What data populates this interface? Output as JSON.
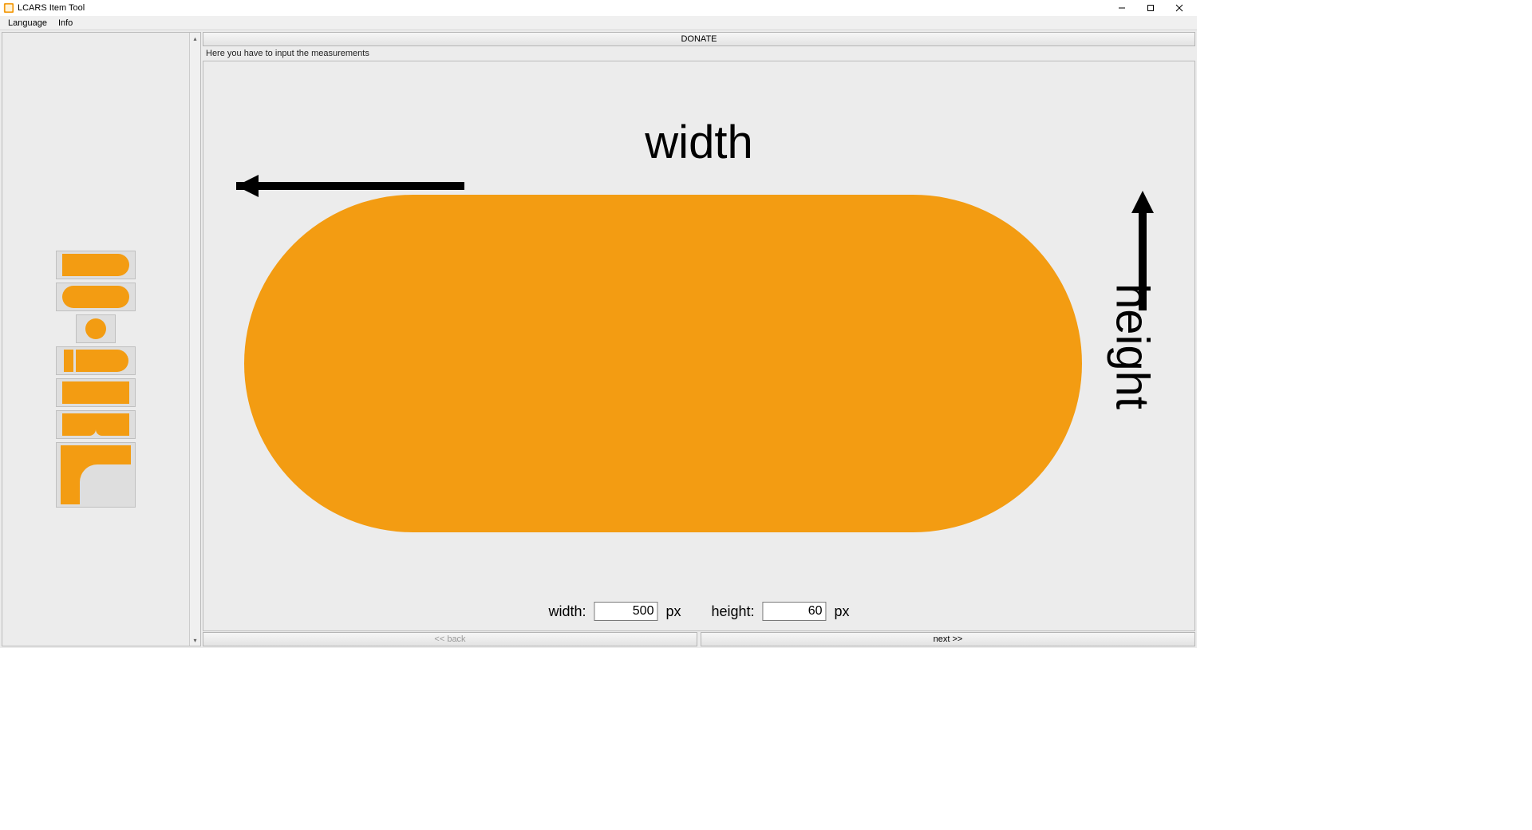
{
  "window": {
    "title": "LCARS Item Tool"
  },
  "menu": {
    "language": "Language",
    "info": "Info"
  },
  "donate": {
    "label": "DONATE"
  },
  "instruction": "Here you have to input the measurements",
  "diagram": {
    "width_label": "width",
    "height_label": "height"
  },
  "form": {
    "width_label": "width:",
    "width_value": "500",
    "width_unit": "px",
    "height_label": "height:",
    "height_value": "60",
    "height_unit": "px"
  },
  "nav": {
    "back": "<< back",
    "next": "next >>"
  }
}
